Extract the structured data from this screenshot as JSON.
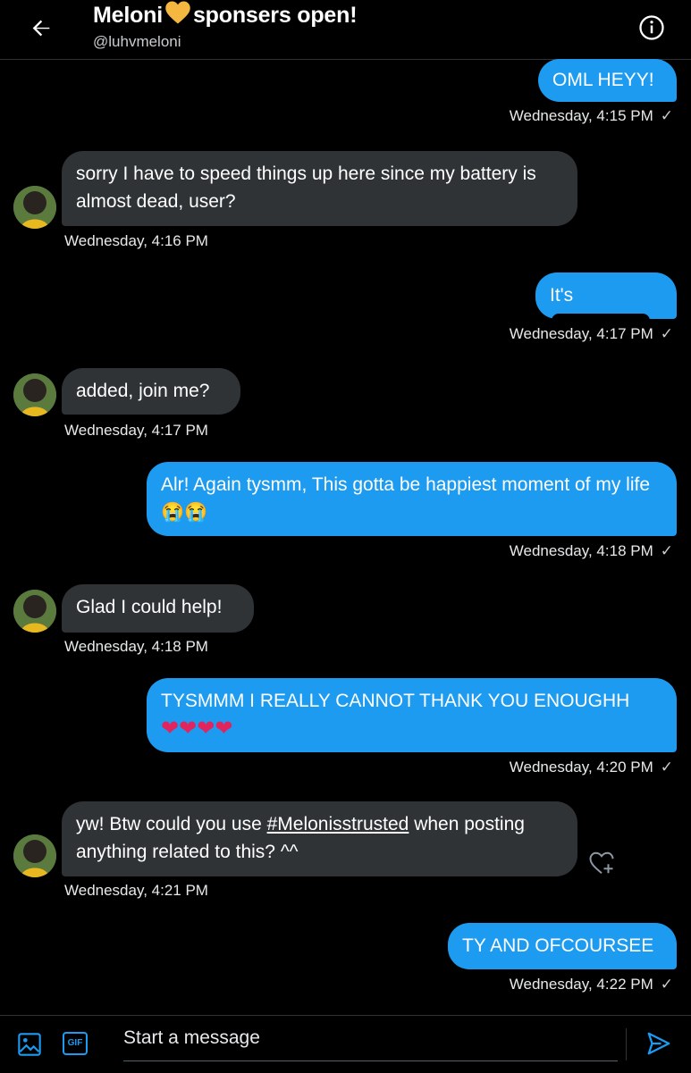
{
  "header": {
    "name": "Meloni",
    "name_suffix": "sponsers open!",
    "handle": "@luhvmeloni"
  },
  "messages": [
    {
      "side": "out",
      "text": "OML HEYY!",
      "time": "Wednesday, 4:15 PM"
    },
    {
      "side": "in",
      "text": "sorry I have to speed things up here since my battery is almost dead, user?",
      "time": "Wednesday, 4:16 PM"
    },
    {
      "side": "out",
      "text": "It's",
      "time": "Wednesday, 4:17 PM"
    },
    {
      "side": "in",
      "text": "added, join me?",
      "time": "Wednesday, 4:17 PM"
    },
    {
      "side": "out",
      "text": "Alr! Again tysmm, This gotta be happiest moment of my life 😭😭",
      "time": "Wednesday, 4:18 PM"
    },
    {
      "side": "in",
      "text": "Glad I could help!",
      "time": "Wednesday, 4:18 PM"
    },
    {
      "side": "out",
      "text": "TYSMMM I REALLY CANNOT THANK YOU ENOUGHH",
      "hearts": "❤❤❤❤",
      "time": "Wednesday, 4:20 PM"
    },
    {
      "side": "in",
      "text_before": "yw! Btw could you use",
      "hashtag": "#Melonisstrusted",
      "text_after": "when posting anything related to this? ^^",
      "time": "Wednesday, 4:21 PM"
    },
    {
      "side": "out",
      "text": "TY AND OFCOURSEE",
      "time": "Wednesday, 4:22 PM"
    }
  ],
  "sent_check": "✓",
  "composer": {
    "placeholder": "Start a message",
    "gif_label": "GIF"
  },
  "colors": {
    "accent": "#1d9bf0",
    "incoming_bubble": "#2f3336",
    "background": "#000000",
    "heart_name": "#f4b740"
  }
}
